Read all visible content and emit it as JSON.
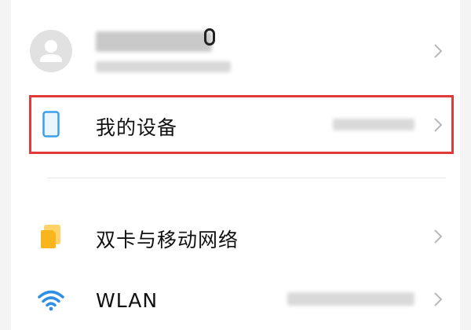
{
  "account": {
    "icon": "avatar-person-icon"
  },
  "my_device": {
    "label": "我的设备",
    "icon": "phone-outline-icon"
  },
  "sim_network": {
    "label": "双卡与移动网络",
    "icon": "sim-cards-icon"
  },
  "wlan": {
    "label": "WLAN",
    "icon": "wifi-icon"
  },
  "colors": {
    "highlight": "#e23a3a",
    "device_icon": "#3aa0e8",
    "sim_icon": "#f8b51c",
    "wifi_icon": "#2f8fe6",
    "chevron": "#b8b8b8"
  }
}
